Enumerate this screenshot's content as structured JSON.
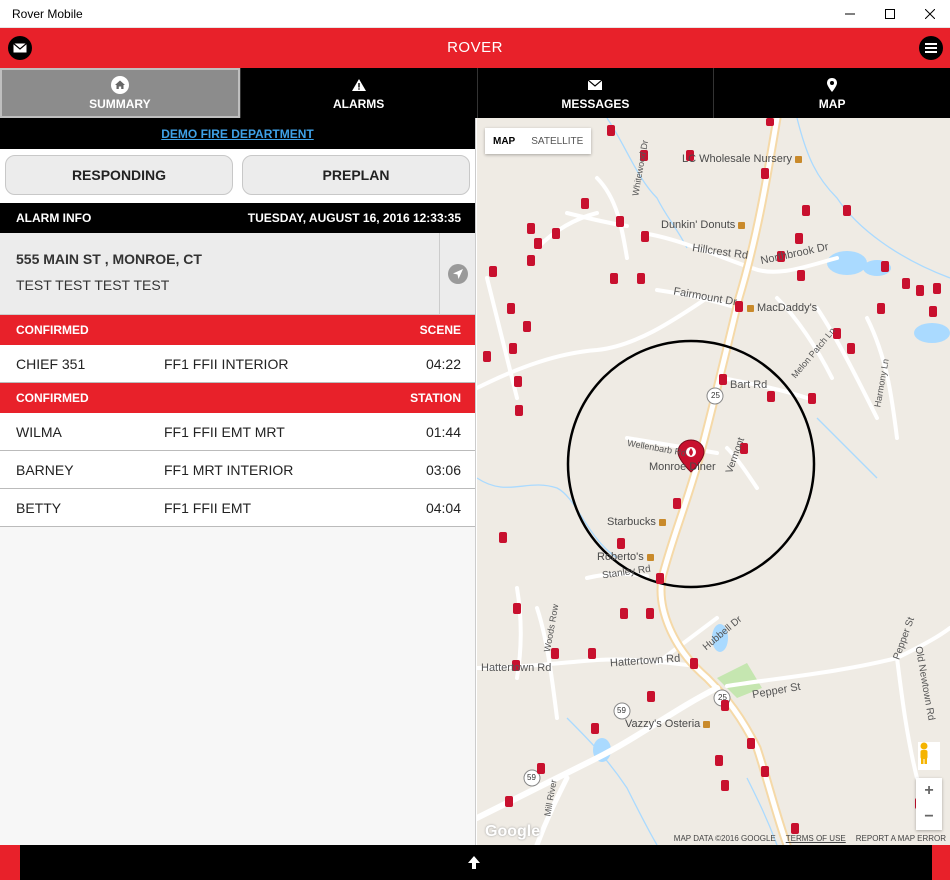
{
  "window": {
    "title": "Rover Mobile"
  },
  "header": {
    "title": "ROVER"
  },
  "tabs": [
    {
      "label": "SUMMARY",
      "icon": "home-icon",
      "active": true
    },
    {
      "label": "ALARMS",
      "icon": "warning-icon",
      "active": false
    },
    {
      "label": "MESSAGES",
      "icon": "envelope-icon",
      "active": false
    },
    {
      "label": "MAP",
      "icon": "map-pin-icon",
      "active": false
    }
  ],
  "summary": {
    "department": "DEMO FIRE DEPARTMENT",
    "responding_label": "RESPONDING",
    "preplan_label": "PREPLAN",
    "alarm_info_label": "ALARM INFO",
    "alarm_datetime": "TUESDAY, AUGUST 16, 2016 12:33:35",
    "address": "555 MAIN ST , MONROE, CT",
    "notes": "TEST TEST TEST TEST",
    "scene": {
      "status": "CONFIRMED",
      "location": "SCENE",
      "responders": [
        {
          "name": "CHIEF 351",
          "quals": "FF1 FFII INTERIOR",
          "time": "04:22"
        }
      ]
    },
    "station": {
      "status": "CONFIRMED",
      "location": "STATION",
      "responders": [
        {
          "name": "WILMA",
          "quals": "FF1 FFII EMT MRT",
          "time": "01:44"
        },
        {
          "name": "BARNEY",
          "quals": "FF1 MRT INTERIOR",
          "time": "03:06"
        },
        {
          "name": "BETTY",
          "quals": "FF1 FFII EMT",
          "time": "04:04"
        }
      ]
    }
  },
  "map": {
    "type_map": "MAP",
    "type_satellite": "SATELLITE",
    "labels": {
      "nursery": "LC Wholesale Nursery",
      "dunkin": "Dunkin' Donuts",
      "macdaddys": "MacDaddy's",
      "monroe_diner": "Monroe Diner",
      "starbucks": "Starbucks",
      "robertos": "Roberto's",
      "vazzys": "Vazzy's Osteria",
      "hillcrest": "Hillcrest Rd",
      "northbrook": "Northbrook Dr",
      "fairmount": "Fairmount Dr",
      "bart": "Bart Rd",
      "pepper": "Pepper St",
      "hattertown": "Hattertown Rd",
      "hattertown2": "Hattertown Rd",
      "hubbell": "Hubbell Dr",
      "stanley": "Stanley Rd",
      "vermont": "Vermont",
      "wellenbarb": "Wellenbarb Rd",
      "melon": "Melon Patch Ln",
      "harmony": "Harmony Ln",
      "old_newtown": "Old Newtown Rd",
      "woods_row": "Woods Row",
      "mill_river": "Mill River",
      "pepper_st2": "Pepper St",
      "whitewood": "Whitewood Dr",
      "route25a": "25",
      "route25b": "25",
      "route59a": "59",
      "route59b": "59"
    },
    "attribution": "MAP DATA ©2016 GOOGLE",
    "terms": "TERMS OF USE",
    "report": "REPORT A MAP ERROR",
    "google": "Google",
    "zoom_in": "+",
    "zoom_out": "−",
    "accent": "#c8102e"
  },
  "colors": {
    "brand_red": "#e8212a",
    "black": "#000000",
    "link_blue": "#3fa2e8"
  }
}
